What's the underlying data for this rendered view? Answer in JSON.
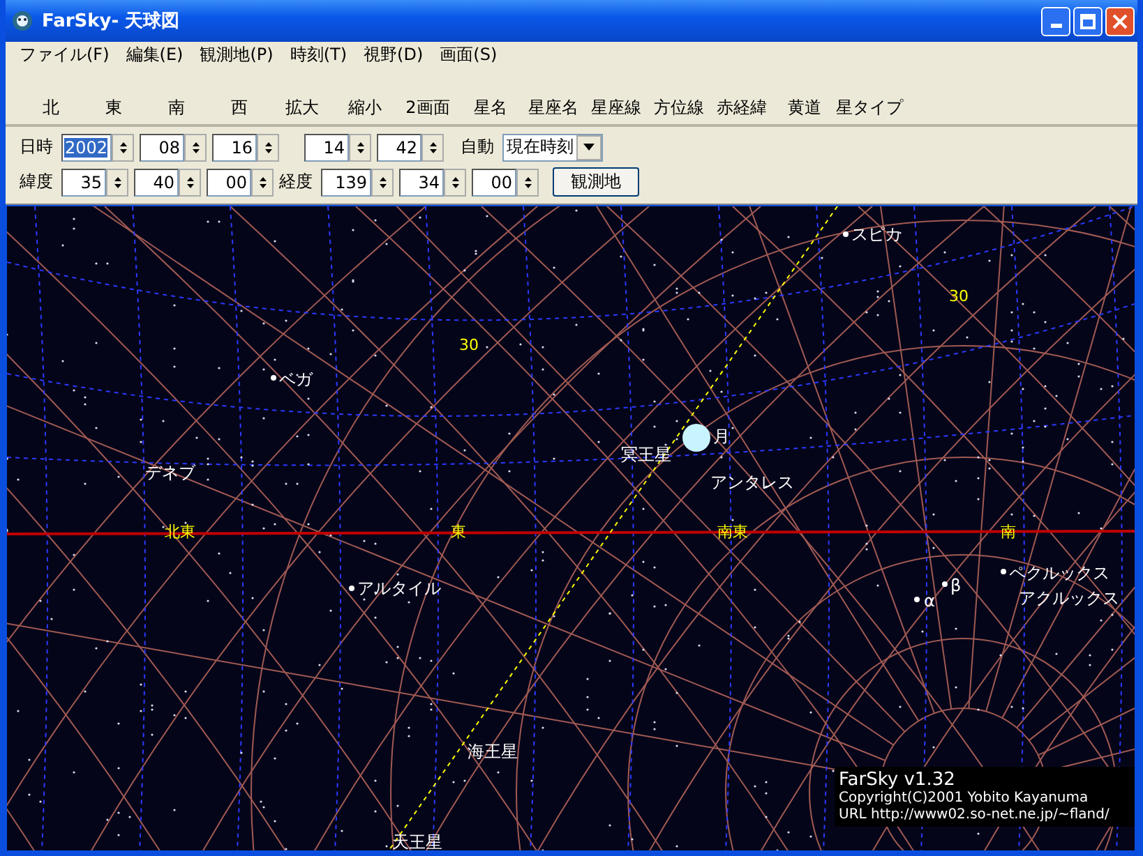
{
  "window": {
    "title": "FarSky- 天球図"
  },
  "menu": [
    "ファイル(F)",
    "編集(E)",
    "観測地(P)",
    "時刻(T)",
    "視野(D)",
    "画面(S)"
  ],
  "toolbar": [
    "北",
    "東",
    "南",
    "西",
    "拡大",
    "縮小",
    "2画面",
    "星名",
    "星座名",
    "星座線",
    "方位線",
    "赤経緯",
    "黄道",
    "星タイプ"
  ],
  "datetime": {
    "label": "日時",
    "date": [
      {
        "value": "2002",
        "selected": true
      },
      {
        "value": "08",
        "selected": false
      },
      {
        "value": "16",
        "selected": false
      }
    ],
    "time": [
      {
        "value": "14",
        "selected": false
      },
      {
        "value": "42",
        "selected": false
      }
    ],
    "auto_label": "自動",
    "mode": "現在時刻"
  },
  "location": {
    "lat_label": "緯度",
    "lat": [
      "35",
      "40",
      "00"
    ],
    "lon_label": "経度",
    "lon": [
      "139",
      "34",
      "00"
    ],
    "button": "観測地"
  },
  "sky": {
    "grid_labels": [
      "30",
      "30"
    ],
    "directions": [
      "北東",
      "東",
      "南東",
      "南"
    ],
    "stars": [
      "スピカ",
      "ベガ",
      "デネブ",
      "アンタレス",
      "アルタイル",
      "ペクルックス",
      "アクルックス",
      "α",
      "β"
    ],
    "planets": [
      "冥王星",
      "海王星",
      "天王星"
    ],
    "moon": "月",
    "credits": [
      "FarSky v1.32",
      "Copyright(C)2001  Yobito Kayanuma",
      "URL  http://www02.so-net.ne.jp/~fland/"
    ]
  }
}
